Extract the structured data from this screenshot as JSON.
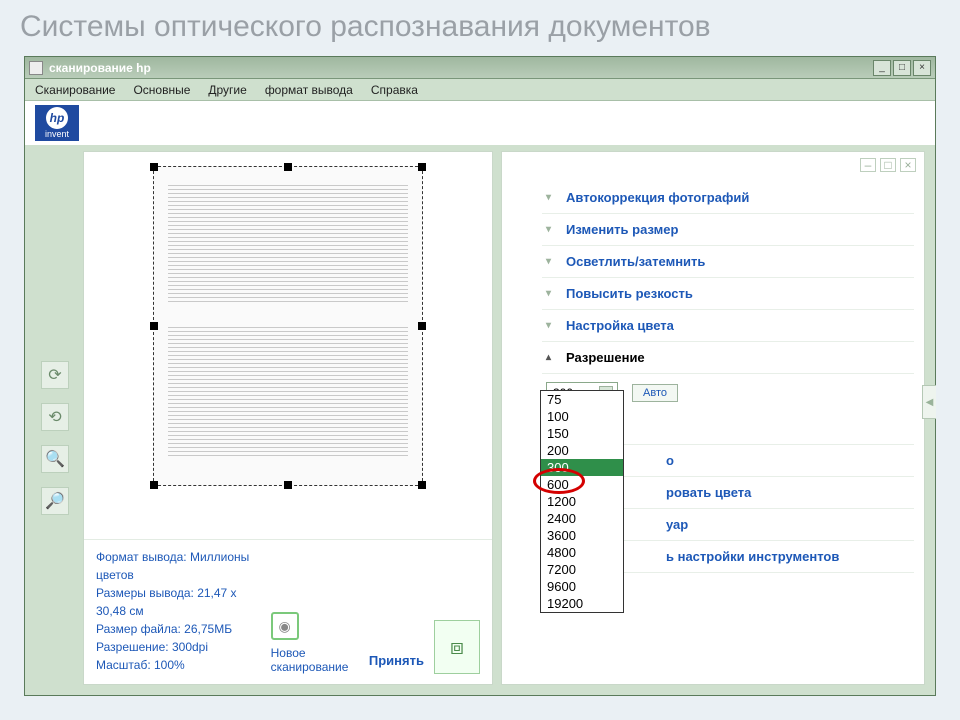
{
  "slide_title": "Системы оптического распознавания документов",
  "window": {
    "title": "сканирование hp",
    "menu": [
      "Сканирование",
      "Основные",
      "Другие",
      "формат вывода",
      "Справка"
    ],
    "hp_sub": "invent"
  },
  "info": {
    "line1": "Формат вывода: Миллионы цветов",
    "line2": "Размеры вывода: 21,47 x",
    "line3": "30,48 см",
    "line4": "Размер файла: 26,75МБ",
    "line5": "Разрешение:  300dpi",
    "line6": "Масштаб: 100%",
    "new_scan": "Новое сканирование",
    "accept": "Принять"
  },
  "accordion": {
    "items": [
      "Автокоррекция фотографий",
      "Изменить размер",
      "Осветлить/затемнить",
      "Повысить резкость",
      "Настройка цвета"
    ],
    "active": "Разрешение",
    "auto": "Авто",
    "selected": "300"
  },
  "dropdown_options": [
    "75",
    "100",
    "150",
    "200",
    "300",
    "600",
    "1200",
    "2400",
    "3600",
    "4800",
    "7200",
    "9600",
    "19200"
  ],
  "below": {
    "frag1": "о",
    "frag2": "ровать цвета",
    "frag3": "уар",
    "frag4": "ь настройки инструментов"
  }
}
